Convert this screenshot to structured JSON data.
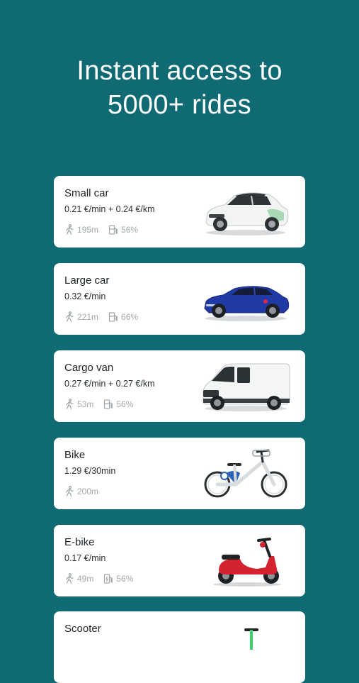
{
  "headline": {
    "line1": "Instant access to",
    "line2": "5000+ rides"
  },
  "vehicles": [
    {
      "title": "Small car",
      "price": "0.21 €/min + 0.24 €/km",
      "distance": "195m",
      "fuel": "56%",
      "image_icon": "small-car-icon",
      "fuel_icon": "fuel-pump-icon"
    },
    {
      "title": "Large car",
      "price": "0.32 €/min",
      "distance": "221m",
      "fuel": "66%",
      "image_icon": "large-car-icon",
      "fuel_icon": "fuel-pump-icon"
    },
    {
      "title": "Cargo van",
      "price": "0.27 €/min + 0.27 €/km",
      "distance": "53m",
      "fuel": "56%",
      "image_icon": "cargo-van-icon",
      "fuel_icon": "fuel-pump-icon"
    },
    {
      "title": "Bike",
      "price": "1.29 €/30min",
      "distance": "200m",
      "image_icon": "bike-icon"
    },
    {
      "title": "E-bike",
      "price": "0.17 €/min",
      "distance": "49m",
      "fuel": "56%",
      "image_icon": "e-bike-icon",
      "fuel_icon": "charge-icon"
    },
    {
      "title": "Scooter",
      "image_icon": "scooter-icon"
    }
  ],
  "colors": {
    "background": "#0f6a73",
    "card": "#ffffff",
    "meta_text": "#a3a8ab"
  }
}
